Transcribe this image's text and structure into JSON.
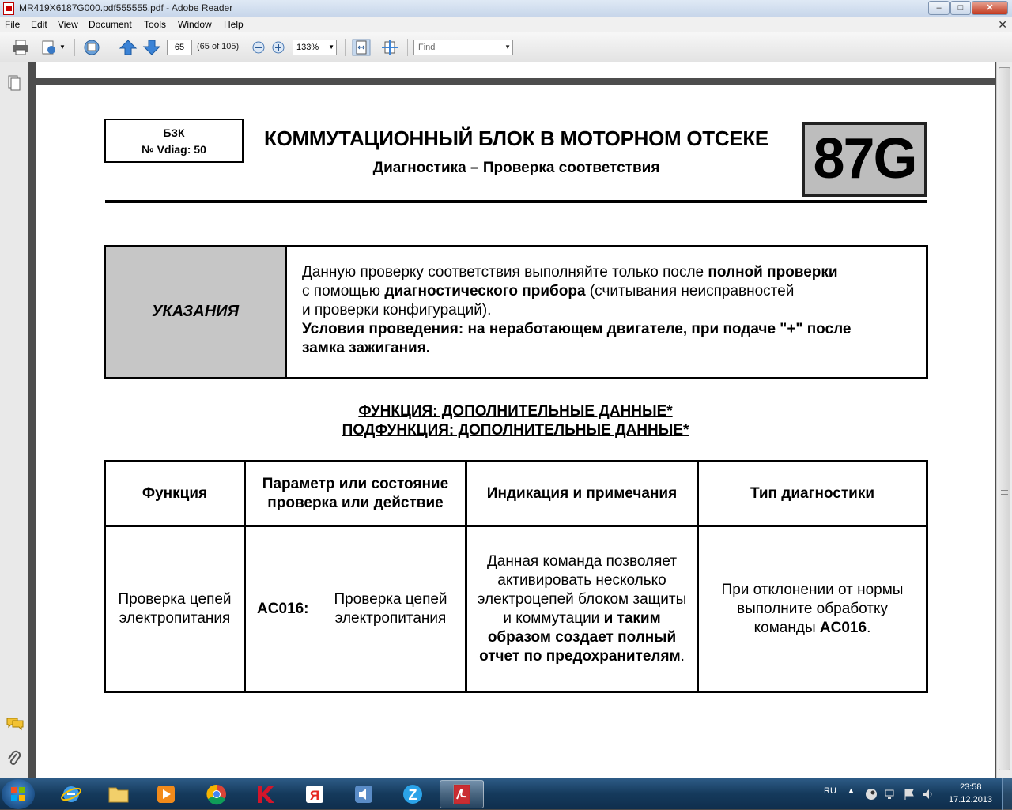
{
  "window": {
    "title": "MR419X6187G000.pdf555555.pdf - Adobe Reader",
    "min": "–",
    "max": "□",
    "close": "✕"
  },
  "menu": [
    "File",
    "Edit",
    "View",
    "Document",
    "Tools",
    "Window",
    "Help"
  ],
  "toolbar": {
    "page_number": "65",
    "page_of": "(65 of 105)",
    "zoom": "133%",
    "find_placeholder": "Find"
  },
  "document": {
    "box_line1": "БЗК",
    "box_line2": "№ Vdiag: 50",
    "title": "КОММУТАЦИОННЫЙ БЛОК В МОТОРНОМ ОТСЕКЕ",
    "subtitle": "Диагностика – Проверка соответствия",
    "badge": "87G",
    "notes_label": "УКАЗАНИЯ",
    "notes": {
      "p1": "Данную проверку соответствия выполняйте только после ",
      "p1b": "полной проверки",
      "p2": "с помощью ",
      "p2b": "диагностического прибора",
      "p2c": " (считывания неисправностей",
      "p3": "и проверки конфигураций).",
      "p4b": "Условия проведения: на неработающем двигателе, при подаче \"+\" после",
      "p5b": "замка зажигания."
    },
    "function_line": "ФУНКЦИЯ: ДОПОЛНИТЕЛЬНЫЕ ДАННЫЕ*",
    "subfunction_line": "ПОДФУНКЦИЯ: ДОПОЛНИТЕЛЬНЫЕ ДАННЫЕ*",
    "table": {
      "headers": [
        "Функция",
        "Параметр или состояние проверка или действие",
        "Индикация и примечания",
        "Тип диагностики"
      ],
      "row": {
        "function": "Проверка цепей электропитания",
        "code": "AC016:",
        "param": "Проверка цепей электропитания",
        "ind1": "Данная команда позволяет активировать несколько электроцепей блоком защиты и коммутации",
        "ind2b": "и таким образом создает полный отчет по предохранителям",
        "ind3": ".",
        "diag1": "При отклонении от нормы выполните обработку команды ",
        "diag_code": "AC016",
        "diag2": "."
      }
    }
  },
  "tray": {
    "lang": "RU",
    "time": "23:58",
    "date": "17.12.2013"
  }
}
